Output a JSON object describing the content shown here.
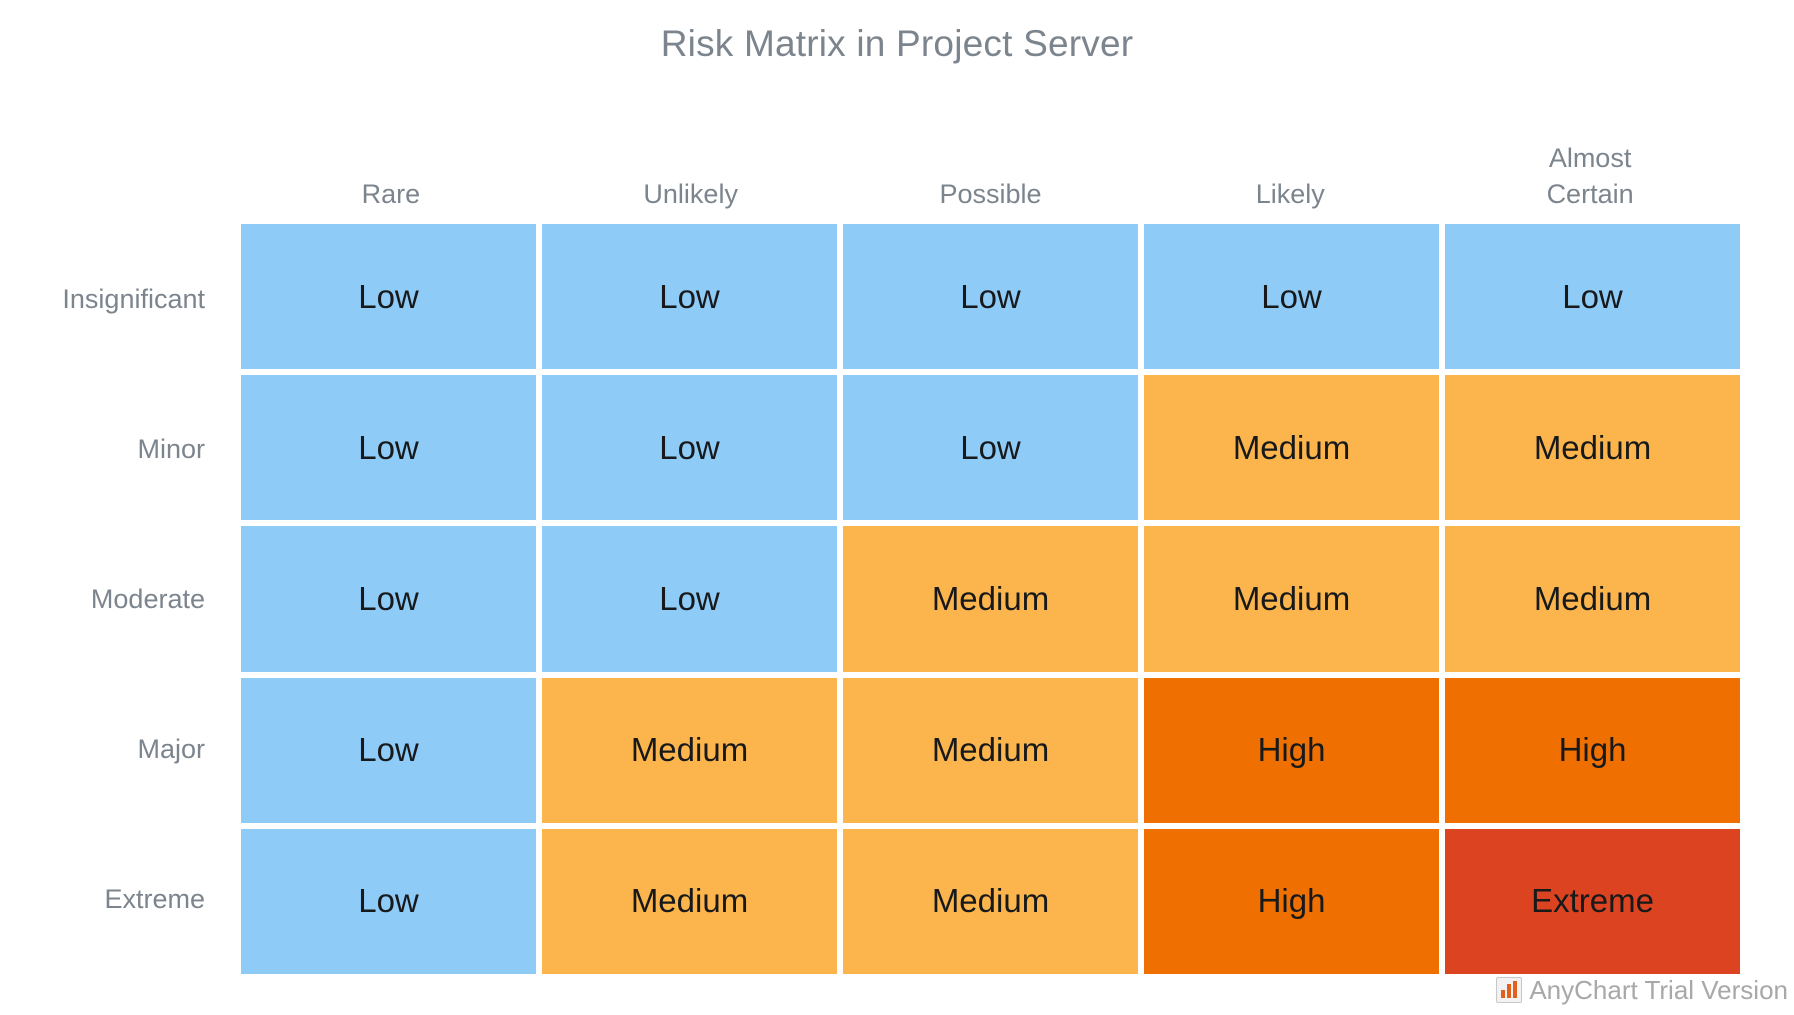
{
  "chart": {
    "title": "Risk Matrix in Project Server",
    "title_color": "#7c858e",
    "axis_label_color": "#7c858e",
    "cell_text_color": "#17191a",
    "background": "#ffffff"
  },
  "watermark": {
    "text": "AnyChart Trial Version",
    "icon": "bar-chart-icon",
    "icon_color": "#e0601c",
    "text_color": "#a8a8a8"
  },
  "legend_colors": {
    "Low": "#8ecbf7",
    "Medium": "#fbb54c",
    "High": "#ef7000",
    "Extreme": "#dc4421"
  },
  "chart_data": {
    "type": "heatmap",
    "title": "Risk Matrix in Project Server",
    "xlabel": "",
    "ylabel": "",
    "grid": false,
    "legend": "none",
    "categories": [
      "Rare",
      "Unlikely",
      "Possible",
      "Likely",
      "Almost\nCertain"
    ],
    "x": [
      "Rare",
      "Unlikely",
      "Possible",
      "Likely",
      "Almost Certain"
    ],
    "y": [
      "Insignificant",
      "Minor",
      "Moderate",
      "Major",
      "Extreme"
    ],
    "rows": [
      {
        "label": "Insignificant",
        "cells": [
          {
            "value": "Low",
            "level": "low",
            "x": "Rare"
          },
          {
            "value": "Low",
            "level": "low",
            "x": "Unlikely"
          },
          {
            "value": "Low",
            "level": "low",
            "x": "Possible"
          },
          {
            "value": "Low",
            "level": "low",
            "x": "Likely"
          },
          {
            "value": "Low",
            "level": "low",
            "x": "Almost Certain"
          }
        ]
      },
      {
        "label": "Minor",
        "cells": [
          {
            "value": "Low",
            "level": "low",
            "x": "Rare"
          },
          {
            "value": "Low",
            "level": "low",
            "x": "Unlikely"
          },
          {
            "value": "Low",
            "level": "low",
            "x": "Possible"
          },
          {
            "value": "Medium",
            "level": "medium",
            "x": "Likely"
          },
          {
            "value": "Medium",
            "level": "medium",
            "x": "Almost Certain"
          }
        ]
      },
      {
        "label": "Moderate",
        "cells": [
          {
            "value": "Low",
            "level": "low",
            "x": "Rare"
          },
          {
            "value": "Low",
            "level": "low",
            "x": "Unlikely"
          },
          {
            "value": "Medium",
            "level": "medium",
            "x": "Possible"
          },
          {
            "value": "Medium",
            "level": "medium",
            "x": "Likely"
          },
          {
            "value": "Medium",
            "level": "medium",
            "x": "Almost Certain"
          }
        ]
      },
      {
        "label": "Major",
        "cells": [
          {
            "value": "Low",
            "level": "low",
            "x": "Rare"
          },
          {
            "value": "Medium",
            "level": "medium",
            "x": "Unlikely"
          },
          {
            "value": "Medium",
            "level": "medium",
            "x": "Possible"
          },
          {
            "value": "High",
            "level": "high",
            "x": "Likely"
          },
          {
            "value": "High",
            "level": "high",
            "x": "Almost Certain"
          }
        ]
      },
      {
        "label": "Extreme",
        "cells": [
          {
            "value": "Low",
            "level": "low",
            "x": "Rare"
          },
          {
            "value": "Medium",
            "level": "medium",
            "x": "Unlikely"
          },
          {
            "value": "Medium",
            "level": "medium",
            "x": "Possible"
          },
          {
            "value": "High",
            "level": "high",
            "x": "Likely"
          },
          {
            "value": "Extreme",
            "level": "extreme",
            "x": "Almost Certain"
          }
        ]
      }
    ]
  }
}
